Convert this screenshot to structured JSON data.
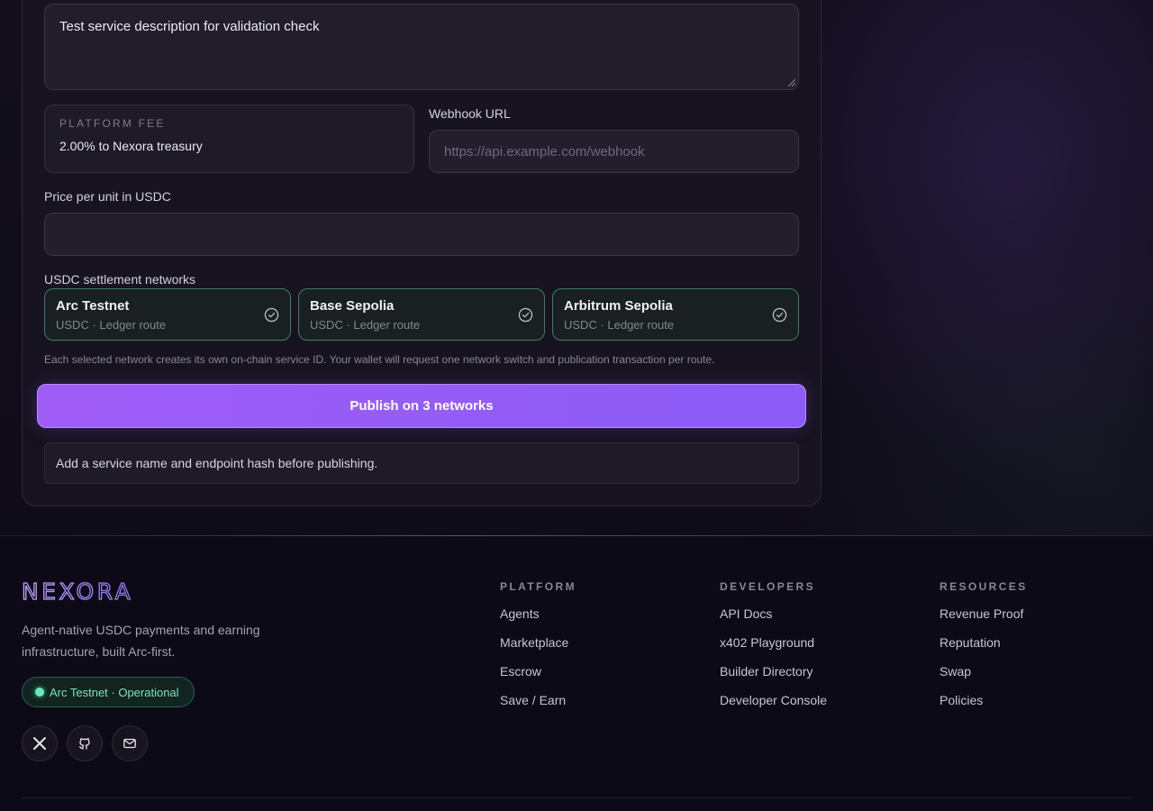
{
  "form": {
    "description_value": "Test service description for validation check",
    "platform_fee_label": "PLATFORM FEE",
    "platform_fee_value": "2.00% to Nexora treasury",
    "webhook_label": "Webhook URL",
    "webhook_placeholder": "https://api.example.com/webhook",
    "price_label": "Price per unit in USDC",
    "price_value": "",
    "networks_label": "USDC settlement networks",
    "networks": [
      {
        "name": "Arc Testnet",
        "sub": "USDC · Ledger route",
        "selected": true
      },
      {
        "name": "Base Sepolia",
        "sub": "USDC · Ledger route",
        "selected": true
      },
      {
        "name": "Arbitrum Sepolia",
        "sub": "USDC · Ledger route",
        "selected": true
      }
    ],
    "networks_hint": "Each selected network creates its own on-chain service ID. Your wallet will request one network switch and publication transaction per route.",
    "publish_label": "Publish on 3 networks",
    "notice": "Add a service name and endpoint hash before publishing."
  },
  "footer": {
    "brand": "NEXORA",
    "tagline": "Agent-native USDC payments and earning infrastructure, built Arc-first.",
    "status": "Arc Testnet · Operational",
    "social": [
      "x-icon",
      "github-icon",
      "mail-icon"
    ],
    "columns": [
      {
        "title": "PLATFORM",
        "links": [
          "Agents",
          "Marketplace",
          "Escrow",
          "Save / Earn"
        ]
      },
      {
        "title": "DEVELOPERS",
        "links": [
          "API Docs",
          "x402 Playground",
          "Builder Directory",
          "Developer Console"
        ]
      },
      {
        "title": "RESOURCES",
        "links": [
          "Revenue Proof",
          "Reputation",
          "Swap",
          "Policies"
        ]
      }
    ]
  },
  "colors": {
    "accent": "#8b5cf6",
    "network_border": "#3e7c6c",
    "status_green": "#6ee7b7"
  }
}
